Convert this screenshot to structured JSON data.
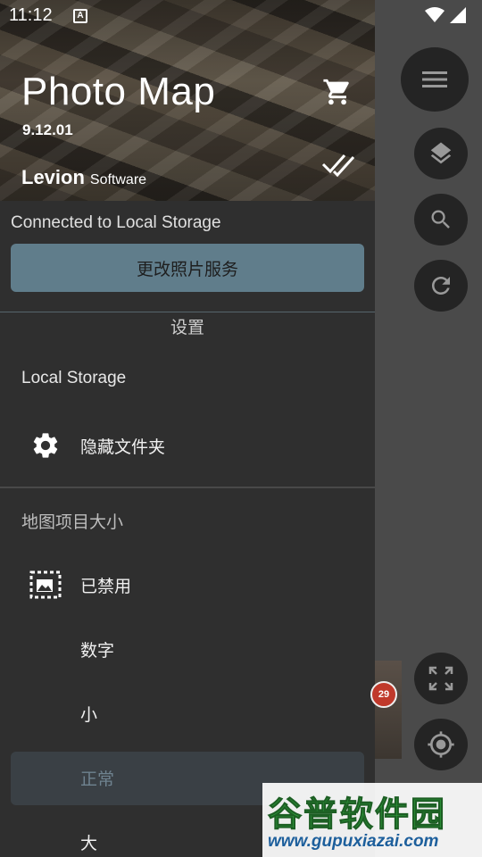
{
  "status_bar": {
    "time": "11:12",
    "notification_letter": "A"
  },
  "drawer": {
    "header": {
      "app_title": "Photo Map",
      "version": "9.12.01",
      "brand_main": "Levion",
      "brand_sub": "Software",
      "cart_icon": "shopping-cart-icon",
      "check_icon": "double-check-icon"
    },
    "connected_text": "Connected to Local Storage",
    "change_service_label": "更改照片服务",
    "settings_heading": "设置",
    "local_storage_section": {
      "title": "Local Storage",
      "items": [
        {
          "label": "隐藏文件夹",
          "icon": "gear-icon"
        }
      ]
    },
    "map_item_size_section": {
      "title": "地图项目大小",
      "options": [
        {
          "label": "已禁用",
          "icon": "image-disabled-icon",
          "selected": false
        },
        {
          "label": "数字",
          "selected": false
        },
        {
          "label": "小",
          "selected": false
        },
        {
          "label": "正常",
          "selected": true
        },
        {
          "label": "大",
          "selected": false
        }
      ]
    }
  },
  "map": {
    "cluster_count": "29",
    "buttons": [
      "menu-icon",
      "layers-icon",
      "search-icon",
      "refresh-icon",
      "fullscreen-icon",
      "my-location-icon"
    ]
  },
  "watermark": {
    "title": "谷普软件园",
    "url": "www.gupuxiazai.com"
  },
  "colors": {
    "accent_button": "#607d8b",
    "drawer_bg": "#2f2f2f",
    "selected_option_bg": "#3a4045",
    "selected_option_text": "#6f8390",
    "badge": "#c0392b"
  }
}
